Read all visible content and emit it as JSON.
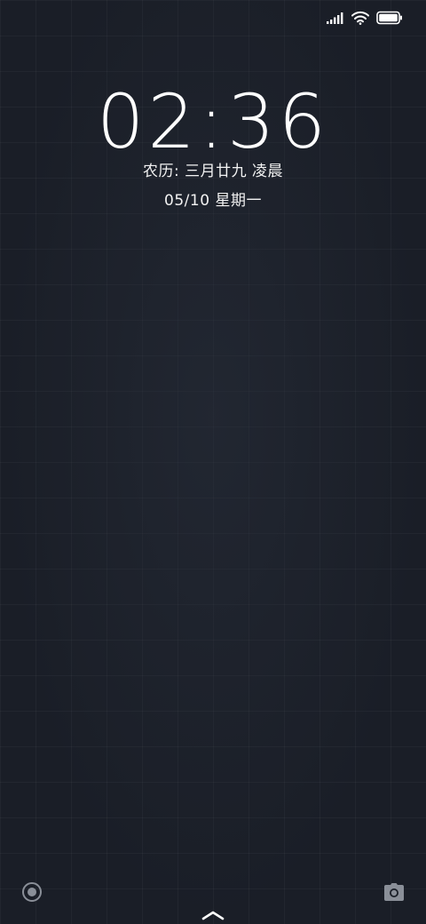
{
  "status_bar": {
    "icons": [
      "signal-icon",
      "wifi-icon",
      "battery-icon"
    ],
    "battery_level": 1.0
  },
  "lockscreen": {
    "time_hours": "02",
    "time_separator": ":",
    "time_minutes": "36",
    "lunar_date": "农历: 三月廿九 凌晨",
    "date": "05/10 星期一"
  },
  "shortcuts": {
    "left_icon": "record-icon",
    "right_icon": "camera-icon",
    "bottom_icon": "chevron-up-icon"
  },
  "colors": {
    "background": "#1a1e27",
    "text": "#ffffff",
    "icon_dim": "#8a8f98"
  }
}
